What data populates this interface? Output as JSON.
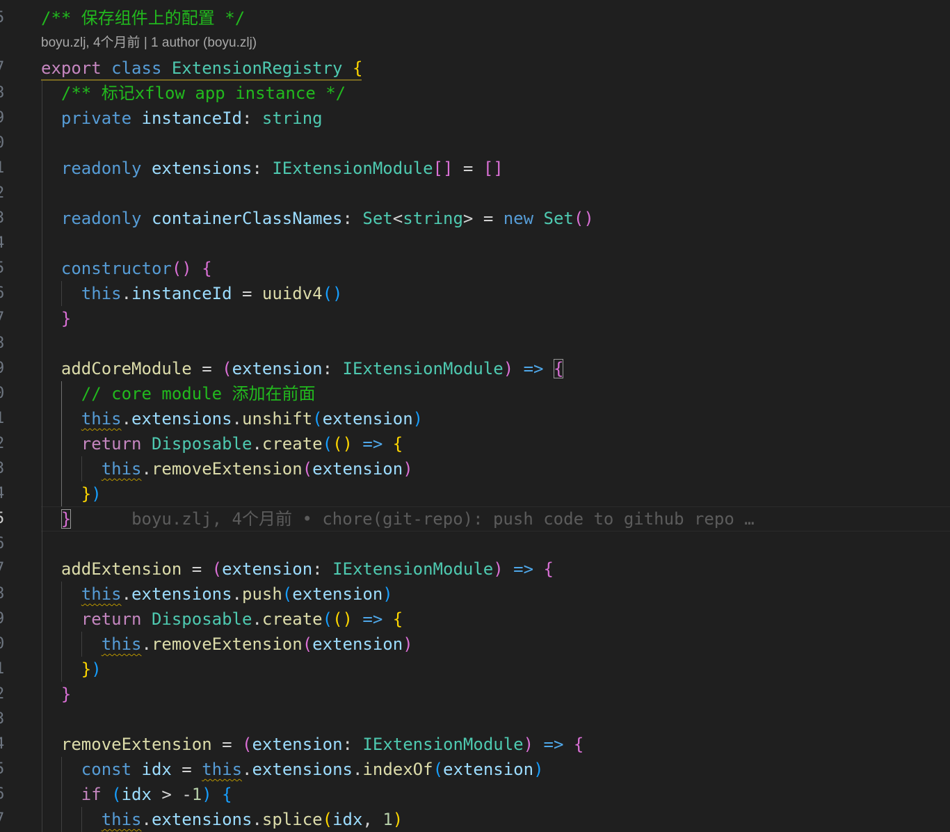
{
  "editor": {
    "file_language": "typescript",
    "colors": {
      "background": "#1f1f1f",
      "comment": "#22b91e",
      "keyword": "#569cd6",
      "type": "#4ec9b0",
      "variable": "#9cdcfe",
      "function": "#dcdcaa",
      "bracket_level_1": "#ffd700",
      "bracket_level_2": "#da70d6",
      "bracket_level_3": "#179fff",
      "warning_squiggle": "#b89500"
    },
    "line_numbers": [
      "5",
      "7",
      "8",
      "9",
      "0",
      "1",
      "2",
      "3",
      "4",
      "5",
      "6",
      "7",
      "8",
      "9",
      "0",
      "1",
      "2",
      "3",
      "4",
      "5",
      "6",
      "7",
      "8",
      "9",
      "0",
      "1",
      "2",
      "3",
      "4",
      "5",
      "6",
      "7"
    ],
    "active_line_number": "5",
    "codelens": "boyu.zlj, 4个月前 | 1 author (boyu.zlj)",
    "inline_blame": "boyu.zlj, 4个月前 • chore(git-repo): push code to github repo …",
    "code": {
      "l1_comment": "/** 保存组件上的配置 */",
      "l2_export": "export",
      "l2_class": "class",
      "l2_name": "ExtensionRegistry",
      "l3_comment": "/** 标记xflow app instance */",
      "l4_private": "private",
      "l4_field": "instanceId",
      "l4_type": "string",
      "l6_readonly": "readonly",
      "l6_field": "extensions",
      "l6_type": "IExtensionModule",
      "l8_readonly": "readonly",
      "l8_field": "containerClassNames",
      "l8_set": "Set",
      "l8_string": "string",
      "l8_new": "new",
      "l8_set2": "Set",
      "l10_ctor": "constructor",
      "this": "this",
      "instanceId": "instanceId",
      "uuidv4": "uuidv4",
      "addCoreModule": "addCoreModule",
      "extension": "extension",
      "IExtensionModule": "IExtensionModule",
      "core_comment": "// core module 添加在前面",
      "extensions": "extensions",
      "unshift": "unshift",
      "return": "return",
      "Disposable": "Disposable",
      "create": "create",
      "removeExtension": "removeExtension",
      "addExtension": "addExtension",
      "push": "push",
      "const": "const",
      "idx": "idx",
      "indexOf": "indexOf",
      "if": "if",
      "one": "1",
      "splice": "splice"
    }
  }
}
